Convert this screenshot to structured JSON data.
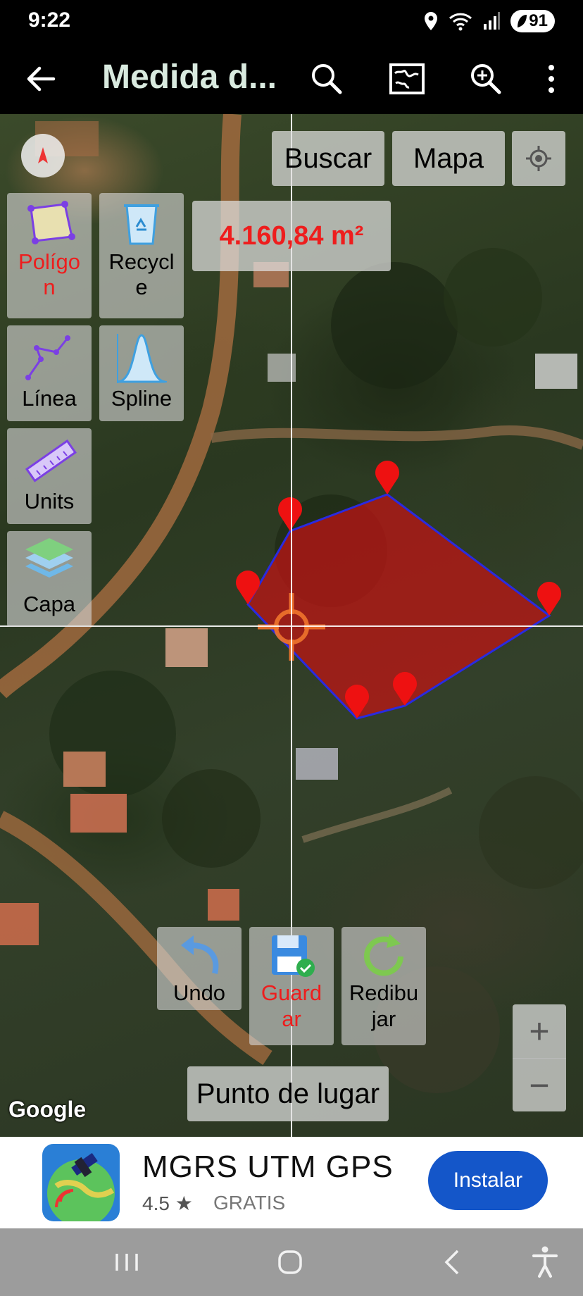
{
  "status_bar": {
    "time": "9:22",
    "battery": "91",
    "icons": [
      "location-icon",
      "wifi-icon",
      "signal-icon",
      "battery-icon"
    ]
  },
  "app_bar": {
    "title": "Medida d...",
    "actions": [
      "search-icon",
      "map-icon",
      "zoom-icon",
      "more-vert-icon"
    ]
  },
  "map": {
    "buttons": {
      "search": "Buscar",
      "map_type": "Mapa",
      "place_point": "Punto de lugar"
    },
    "area_display": "4.160,84 m²",
    "tools": [
      {
        "id": "polygon",
        "label_line1": "Polígo",
        "label_line2": "n",
        "active": true
      },
      {
        "id": "recycle",
        "label_line1": "Recycl",
        "label_line2": "e",
        "active": false
      },
      {
        "id": "line",
        "label_line1": "Línea",
        "label_line2": "",
        "active": false
      },
      {
        "id": "spline",
        "label_line1": "Spline",
        "label_line2": "",
        "active": false
      },
      {
        "id": "units",
        "label_line1": "Units",
        "label_line2": "",
        "active": false
      },
      {
        "id": "layer",
        "label_line1": "Capa",
        "label_line2": "",
        "active": false
      }
    ],
    "bottom_tools": [
      {
        "id": "undo",
        "label_line1": "Undo",
        "label_line2": ""
      },
      {
        "id": "save",
        "label_line1": "Guard",
        "label_line2": "ar"
      },
      {
        "id": "redraw",
        "label_line1": "Redibu",
        "label_line2": "jar"
      }
    ],
    "zoom_in": "+",
    "zoom_out": "−",
    "attribution": "Google",
    "polygon_fill": "#c41414",
    "polygon_stroke": "#2a2ae0",
    "marker_color": "#ee1111"
  },
  "ad": {
    "app_name": "MGRS UTM GPS",
    "rating": "4.5 ★",
    "price": "GRATIS",
    "install_label": "Instalar",
    "accent": "#1456c9"
  },
  "nav_bar": {
    "buttons": [
      "recents-icon",
      "home-icon",
      "back-icon",
      "accessibility-icon"
    ]
  }
}
